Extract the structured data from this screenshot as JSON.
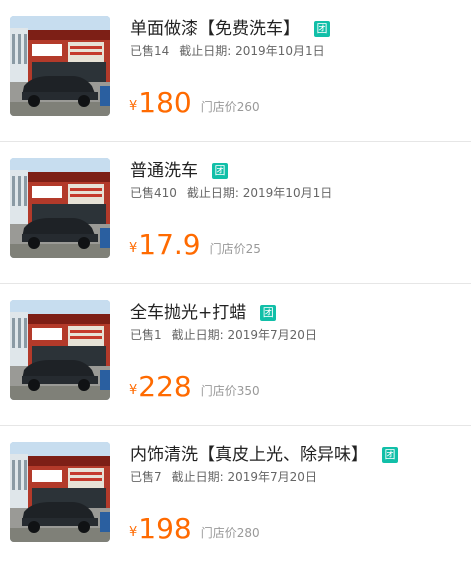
{
  "items": [
    {
      "title": "单面做漆【免费洗车】",
      "badge": "团",
      "sold": "已售14",
      "deadline": "截止日期:  2019年10月1日",
      "currency": "¥",
      "price": "180",
      "store_price": "门店价260"
    },
    {
      "title": "普通洗车",
      "badge": "团",
      "sold": "已售410",
      "deadline": "截止日期:  2019年10月1日",
      "currency": "¥",
      "price": "17.9",
      "store_price": "门店价25"
    },
    {
      "title": "全车抛光+打蜡",
      "badge": "团",
      "sold": "已售1",
      "deadline": "截止日期:  2019年7月20日",
      "currency": "¥",
      "price": "228",
      "store_price": "门店价350"
    },
    {
      "title": "内饰清洗【真皮上光、除异味】",
      "badge": "团",
      "sold": "已售7",
      "deadline": "截止日期:  2019年7月20日",
      "currency": "¥",
      "price": "198",
      "store_price": "门店价280"
    }
  ],
  "colors": {
    "accent_price": "#ff6a00",
    "badge_bg": "#11bfa8",
    "divider": "#e6e6e6"
  }
}
